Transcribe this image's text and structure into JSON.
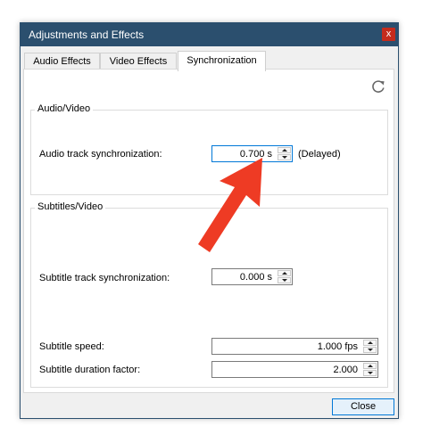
{
  "window": {
    "title": "Adjustments and Effects",
    "close_glyph": "x"
  },
  "tabs": [
    {
      "label": "Audio Effects",
      "active": false
    },
    {
      "label": "Video Effects",
      "active": false
    },
    {
      "label": "Synchronization",
      "active": true
    }
  ],
  "toolbar": {
    "reset_icon": "refresh-icon"
  },
  "audio_video": {
    "group_label": "Audio/Video",
    "audio_sync_label": "Audio track synchronization:",
    "audio_sync_value": "0.700 s",
    "audio_sync_status": "(Delayed)"
  },
  "subtitles_video": {
    "group_label": "Subtitles/Video",
    "subtitle_sync_label": "Subtitle track synchronization:",
    "subtitle_sync_value": "0.000 s",
    "subtitle_speed_label": "Subtitle speed:",
    "subtitle_speed_value": "1.000 fps",
    "subtitle_duration_label": "Subtitle duration factor:",
    "subtitle_duration_value": "2.000"
  },
  "footer": {
    "close_label": "Close"
  },
  "colors": {
    "titlebar": "#2b4f6e",
    "accent": "#0078d7",
    "annotation_arrow": "#ee3b24",
    "close_x": "#c42b1c"
  }
}
